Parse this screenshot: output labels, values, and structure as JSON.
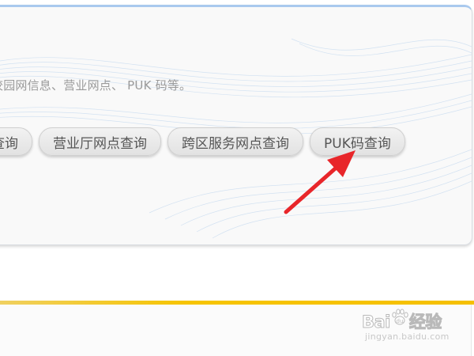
{
  "panel": {
    "description": "校园网信息、营业网点、 PUK 码等。",
    "buttons": [
      {
        "label": "查询"
      },
      {
        "label": "营业厅网点查询"
      },
      {
        "label": "跨区服务网点查询"
      },
      {
        "label": "PUK码查询"
      }
    ]
  },
  "annotation": {
    "arrow_color": "#e8262a",
    "target": "PUK码查询"
  },
  "watermark": {
    "brand_left": "Bai",
    "brand_right": "经验",
    "sub": "jingyan.baidu.com"
  },
  "colors": {
    "panel_border_top": "#a9c9ee",
    "bottom_bar": "#f5c000",
    "arrow": "#e8262a"
  }
}
